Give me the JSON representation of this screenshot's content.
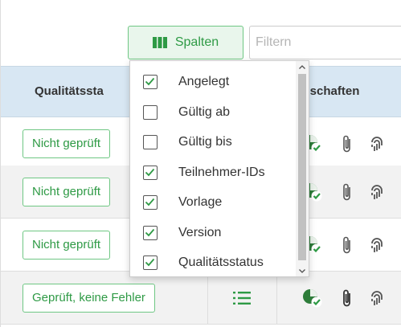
{
  "toolbar": {
    "columns_button_label": "Spalten",
    "columns_icon": "columns-icon",
    "filter_placeholder": "Filtern"
  },
  "table": {
    "headers": {
      "quality_status": "Qualitätssta",
      "properties": "genschaften"
    },
    "rows": [
      {
        "status": "Nicht geprüft",
        "icons": [
          "check-user-icon",
          "paperclip-icon",
          "fingerprint-icon"
        ]
      },
      {
        "status": "Nicht geprüft",
        "icons": [
          "check-user-icon",
          "paperclip-icon",
          "fingerprint-icon"
        ]
      },
      {
        "status": "Nicht geprüft",
        "icons": [
          "check-user-icon",
          "paperclip-icon",
          "fingerprint-icon"
        ]
      },
      {
        "status": "Geprüft, keine Fehler",
        "icons": [
          "list-icon",
          "check-user-icon",
          "paperclip-icon",
          "fingerprint-icon"
        ]
      }
    ]
  },
  "column_menu": {
    "options": [
      {
        "label": "Angelegt",
        "checked": true
      },
      {
        "label": "Gültig ab",
        "checked": false
      },
      {
        "label": "Gültig bis",
        "checked": false
      },
      {
        "label": "Teilnehmer-IDs",
        "checked": true
      },
      {
        "label": "Vorlage",
        "checked": true
      },
      {
        "label": "Version",
        "checked": true
      },
      {
        "label": "Qualitätsstatus",
        "checked": true
      }
    ]
  },
  "colors": {
    "accent_green": "#2e9a45",
    "button_border": "#6fc784",
    "header_background": "#d8e7f3"
  }
}
